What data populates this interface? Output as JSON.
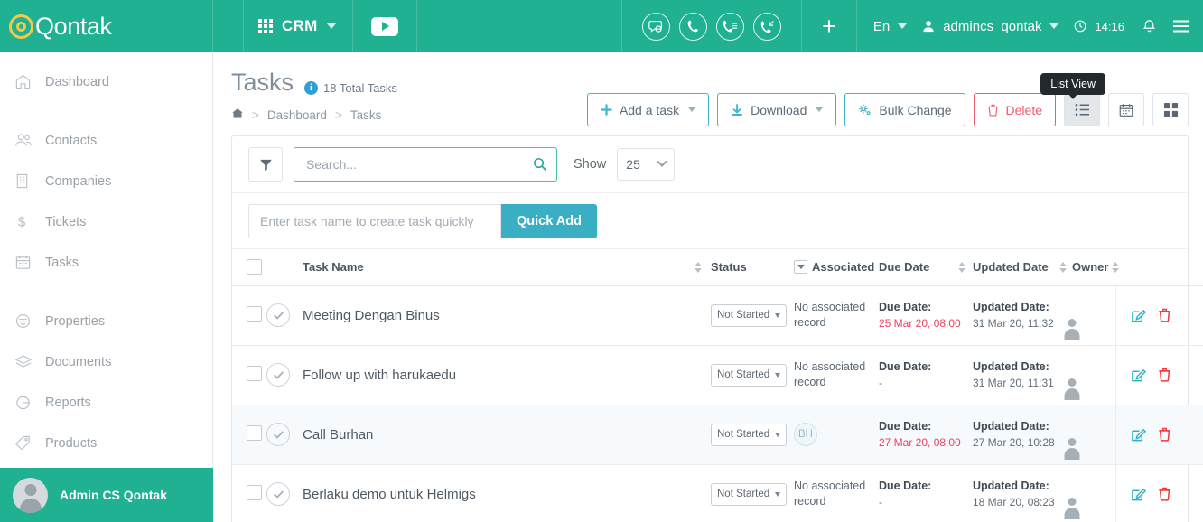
{
  "topbar": {
    "brand_name": "Qontak",
    "collapse_icon": "collapse-menu-icon",
    "module_label": "CRM",
    "module_caret": "chevron-down-icon",
    "video_icon": "youtube-play-icon",
    "comm_icons": [
      "chat-bubble-icon",
      "phone-icon",
      "call-log-icon",
      "call-inbound-icon"
    ],
    "plus_label": "+",
    "language": "En",
    "user_name": "admincs_qontak",
    "clock": "14:16",
    "bell_icon": "notification-bell-icon",
    "menu_icon": "hamburger-menu-icon"
  },
  "sidebar": {
    "items": [
      {
        "label": "Dashboard",
        "icon": "home-icon"
      },
      {
        "label": "Contacts",
        "icon": "contacts-icon"
      },
      {
        "label": "Companies",
        "icon": "building-icon"
      },
      {
        "label": "Tickets",
        "icon": "dollar-icon"
      },
      {
        "label": "Tasks",
        "icon": "calendar-icon"
      },
      {
        "label": "Properties",
        "icon": "properties-icon"
      },
      {
        "label": "Documents",
        "icon": "documents-icon"
      },
      {
        "label": "Reports",
        "icon": "pie-chart-icon"
      },
      {
        "label": "Products",
        "icon": "tag-icon"
      }
    ],
    "footer_user": "Admin CS Qontak"
  },
  "page": {
    "title": "Tasks",
    "total_text": "18 Total Tasks",
    "info_glyph": "i",
    "breadcrumb": {
      "home_icon": "home-icon",
      "items": [
        "Dashboard",
        "Tasks"
      ],
      "separator": ">"
    }
  },
  "actions": {
    "add_task": "Add a task",
    "download": "Download",
    "bulk_change": "Bulk Change",
    "delete": "Delete",
    "tooltip": "List View",
    "views": [
      {
        "name": "list-view",
        "active": true
      },
      {
        "name": "calendar-view",
        "active": false
      },
      {
        "name": "grid-view",
        "active": false
      }
    ]
  },
  "toolbar": {
    "filter_icon": "funnel-filter-icon",
    "search_placeholder": "Search...",
    "search_value": "",
    "search_icon": "search-icon",
    "show_label": "Show",
    "show_value": "25"
  },
  "quick_add": {
    "placeholder": "Enter task name to create task quickly",
    "value": "",
    "button": "Quick Add"
  },
  "table": {
    "columns": [
      {
        "label": "Task Name",
        "sortable": true
      },
      {
        "label": "Status",
        "sortable": false,
        "filterable": true
      },
      {
        "label": "Associated",
        "sortable": false
      },
      {
        "label": "Due Date",
        "sortable": true
      },
      {
        "label": "Updated Date",
        "sortable": true
      },
      {
        "label": "Owner",
        "sortable": true
      }
    ],
    "due_label": "Due Date:",
    "updated_label": "Updated Date:",
    "rows": [
      {
        "name": "Meeting Dengan Binus",
        "status": "Not Started",
        "associated": "No associated record",
        "associated_badge": "",
        "due_date": "25 Mar 20, 08:00",
        "due_overdue": true,
        "updated_date": "31 Mar 20, 11:32",
        "owner": "avatar-placeholder"
      },
      {
        "name": "Follow up with harukaedu",
        "status": "Not Started",
        "associated": "No associated record",
        "associated_badge": "",
        "due_date": "-",
        "due_overdue": false,
        "updated_date": "31 Mar 20, 11:31",
        "owner": "avatar-placeholder"
      },
      {
        "name": "Call Burhan",
        "status": "Not Started",
        "associated": "",
        "associated_badge": "BH",
        "due_date": "27 Mar 20, 08:00",
        "due_overdue": true,
        "updated_date": "27 Mar 20, 10:28",
        "owner": "avatar-placeholder"
      },
      {
        "name": "Berlaku demo untuk Helmigs",
        "status": "Not Started",
        "associated": "No associated record",
        "associated_badge": "",
        "due_date": "-",
        "due_overdue": false,
        "updated_date": "18 Mar 20, 08:23",
        "owner": "avatar-placeholder"
      }
    ]
  },
  "colors": {
    "brand_teal": "#20b092",
    "accent_blue": "#3cb6c9",
    "danger_red": "#ef5b6e",
    "overdue_red": "#ee3f5c",
    "quick_add": "#3aafc4",
    "logo_gold": "#f2c94c"
  }
}
